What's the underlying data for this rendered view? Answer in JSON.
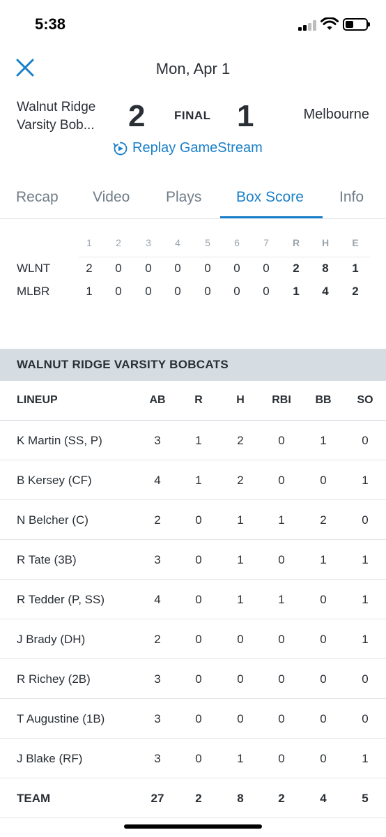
{
  "status_bar": {
    "time": "5:38"
  },
  "header": {
    "title": "Mon, Apr 1"
  },
  "game": {
    "home_team": "Walnut Ridge Varsity Bob...",
    "home_score": "2",
    "status": "FINAL",
    "away_score": "1",
    "away_team": "Melbourne",
    "replay_label": "Replay GameStream"
  },
  "tabs": [
    {
      "label": "Recap"
    },
    {
      "label": "Video"
    },
    {
      "label": "Plays"
    },
    {
      "label": "Box Score",
      "active": true
    },
    {
      "label": "Info"
    }
  ],
  "linescore": {
    "columns": [
      "1",
      "2",
      "3",
      "4",
      "5",
      "6",
      "7",
      "R",
      "H",
      "E"
    ],
    "rows": [
      {
        "team": "WLNT",
        "values": [
          "2",
          "0",
          "0",
          "0",
          "0",
          "0",
          "0",
          "2",
          "8",
          "1"
        ]
      },
      {
        "team": "MLBR",
        "values": [
          "1",
          "0",
          "0",
          "0",
          "0",
          "0",
          "0",
          "1",
          "4",
          "2"
        ]
      }
    ]
  },
  "team_section": {
    "name": "WALNUT RIDGE VARSITY BOBCATS"
  },
  "box": {
    "headers": [
      "LINEUP",
      "AB",
      "R",
      "H",
      "RBI",
      "BB",
      "SO"
    ],
    "players": [
      {
        "name": "K Martin (SS, P)",
        "stats": [
          "3",
          "1",
          "2",
          "0",
          "1",
          "0"
        ]
      },
      {
        "name": "B Kersey (CF)",
        "stats": [
          "4",
          "1",
          "2",
          "0",
          "0",
          "1"
        ]
      },
      {
        "name": "N Belcher (C)",
        "stats": [
          "2",
          "0",
          "1",
          "1",
          "2",
          "0"
        ]
      },
      {
        "name": "R Tate (3B)",
        "stats": [
          "3",
          "0",
          "1",
          "0",
          "1",
          "1"
        ]
      },
      {
        "name": "R Tedder (P, SS)",
        "stats": [
          "4",
          "0",
          "1",
          "1",
          "0",
          "1"
        ]
      },
      {
        "name": "J Brady (DH)",
        "stats": [
          "2",
          "0",
          "0",
          "0",
          "0",
          "1"
        ]
      },
      {
        "name": "R Richey (2B)",
        "stats": [
          "3",
          "0",
          "0",
          "0",
          "0",
          "0"
        ]
      },
      {
        "name": "T Augustine (1B)",
        "stats": [
          "3",
          "0",
          "0",
          "0",
          "0",
          "0"
        ]
      },
      {
        "name": "J Blake (RF)",
        "stats": [
          "3",
          "0",
          "1",
          "0",
          "0",
          "1"
        ]
      }
    ],
    "total": {
      "name": "TEAM",
      "stats": [
        "27",
        "2",
        "8",
        "2",
        "4",
        "5"
      ]
    }
  },
  "colors": {
    "accent": "#1a7fc9",
    "banner": "#d5dde3",
    "text": "#2a2f35",
    "muted": "#9aa4ad"
  },
  "icons": {
    "close": "close-icon",
    "replay": "replay-icon"
  }
}
